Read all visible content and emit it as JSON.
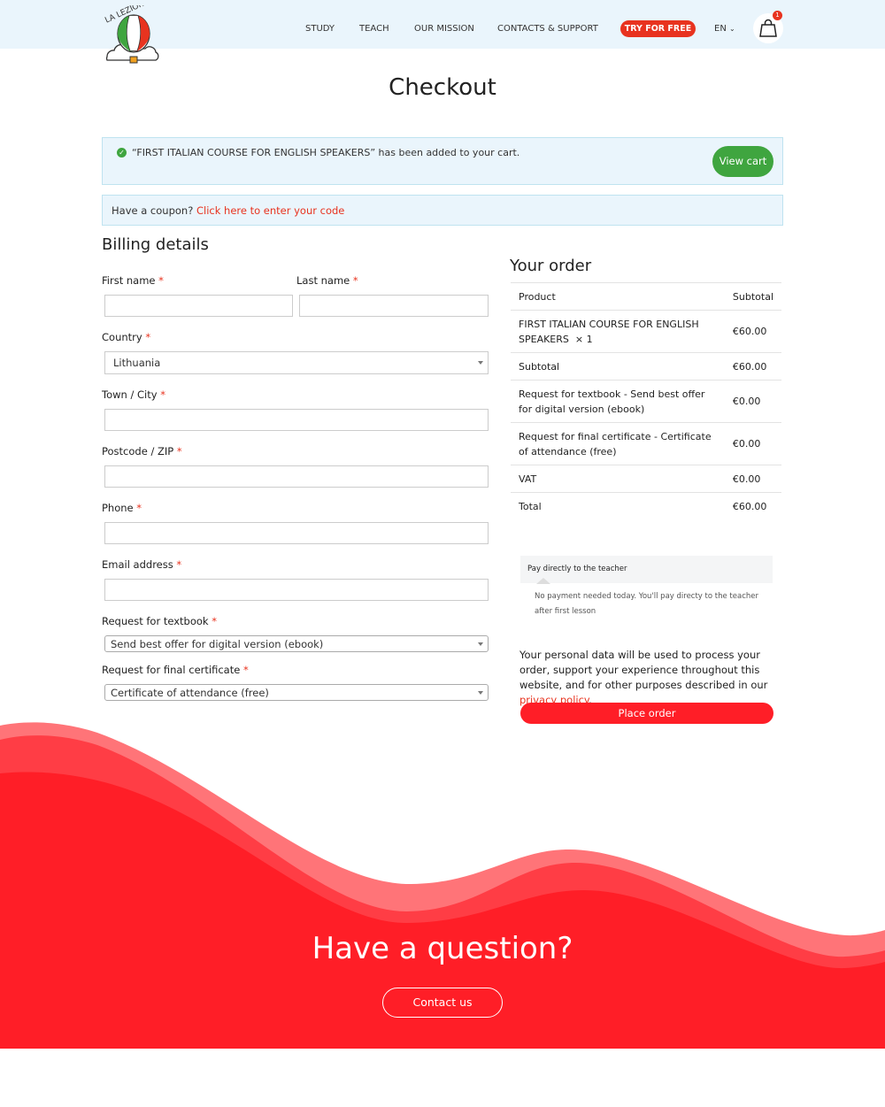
{
  "header": {
    "logo_text": "LA LEZIONE",
    "nav": [
      "STUDY",
      "TEACH",
      "OUR MISSION",
      "CONTACTS & SUPPORT"
    ],
    "try_button": "TRY FOR FREE",
    "language": "EN",
    "cart_count": "1"
  },
  "page_title": "Checkout",
  "notice": {
    "message": "“FIRST ITALIAN COURSE FOR ENGLISH SPEAKERS” has been added to your cart.",
    "view_cart": "View cart"
  },
  "coupon": {
    "text": "Have a coupon?",
    "link": "Click here to enter your code"
  },
  "billing": {
    "title": "Billing details",
    "required_mark": "*",
    "first_name": "First name",
    "last_name": "Last name",
    "country": "Country",
    "country_value": "Lithuania",
    "town": "Town / City",
    "postcode": "Postcode / ZIP",
    "phone": "Phone",
    "email": "Email address",
    "textbook": "Request for textbook",
    "textbook_value": "Send best offer for digital version (ebook)",
    "certificate": "Request for final certificate",
    "certificate_value": "Certificate of attendance (free)"
  },
  "order": {
    "title": "Your order",
    "header": {
      "product": "Product",
      "subtotal": "Subtotal"
    },
    "rows": [
      {
        "label": "FIRST ITALIAN COURSE FOR ENGLISH SPEAKERS",
        "qty": "× 1",
        "value": "€60.00"
      },
      {
        "label": "Subtotal",
        "value": "€60.00"
      },
      {
        "label": "Request for textbook - Send best offer for digital version (ebook)",
        "value": "€0.00"
      },
      {
        "label": "Request for final certificate - Certificate of attendance (free)",
        "value": "€0.00"
      },
      {
        "label": "VAT",
        "value": "€0.00"
      },
      {
        "label": "Total",
        "value": "€60.00"
      }
    ],
    "payment_method": "Pay directly to the teacher",
    "payment_desc": "No payment needed today. You'll pay directy to the teacher after first lesson",
    "privacy_text": "Your personal data will be used to process your order, support your experience throughout this website, and for other purposes described in our",
    "privacy_link": "privacy policy",
    "privacy_end": ".",
    "place_order": "Place order"
  },
  "footer": {
    "question": "Have a question?",
    "contact": "Contact us"
  },
  "colors": {
    "accent": "#ff1e27",
    "header_bg": "#eaf5fc",
    "success": "#3fa53f"
  }
}
